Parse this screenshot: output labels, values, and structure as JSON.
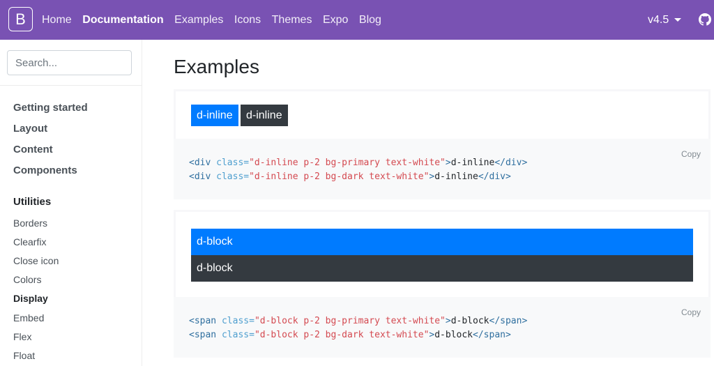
{
  "navbar": {
    "brand": "B",
    "links": [
      "Home",
      "Documentation",
      "Examples",
      "Icons",
      "Themes",
      "Expo",
      "Blog"
    ],
    "version": "v4.5"
  },
  "sidebar": {
    "search_placeholder": "Search...",
    "sections": [
      "Getting started",
      "Layout",
      "Content",
      "Components"
    ],
    "utilities_heading": "Utilities",
    "utilities": [
      "Borders",
      "Clearfix",
      "Close icon",
      "Colors",
      "Display",
      "Embed",
      "Flex",
      "Float"
    ],
    "active_utility": "Display"
  },
  "main": {
    "title": "Examples",
    "examples": [
      {
        "demo": [
          "d-inline",
          "d-inline"
        ],
        "copy": "Copy",
        "code": [
          {
            "open": "<div",
            "attr": " class=",
            "value": "\"d-inline p-2 bg-primary text-white\"",
            "gt": ">",
            "text": "d-inline",
            "close": "</div>"
          },
          {
            "open": "<div",
            "attr": " class=",
            "value": "\"d-inline p-2 bg-dark text-white\"",
            "gt": ">",
            "text": "d-inline",
            "close": "</div>"
          }
        ]
      },
      {
        "demo": [
          "d-block",
          "d-block"
        ],
        "copy": "Copy",
        "code": [
          {
            "open": "<span",
            "attr": " class=",
            "value": "\"d-block p-2 bg-primary text-white\"",
            "gt": ">",
            "text": "d-block",
            "close": "</span>"
          },
          {
            "open": "<span",
            "attr": " class=",
            "value": "\"d-block p-2 bg-dark text-white\"",
            "gt": ">",
            "text": "d-block",
            "close": "</span>"
          }
        ]
      }
    ]
  },
  "colors": {
    "brand": "#7952b3",
    "primary": "#007bff",
    "dark": "#343a40"
  }
}
